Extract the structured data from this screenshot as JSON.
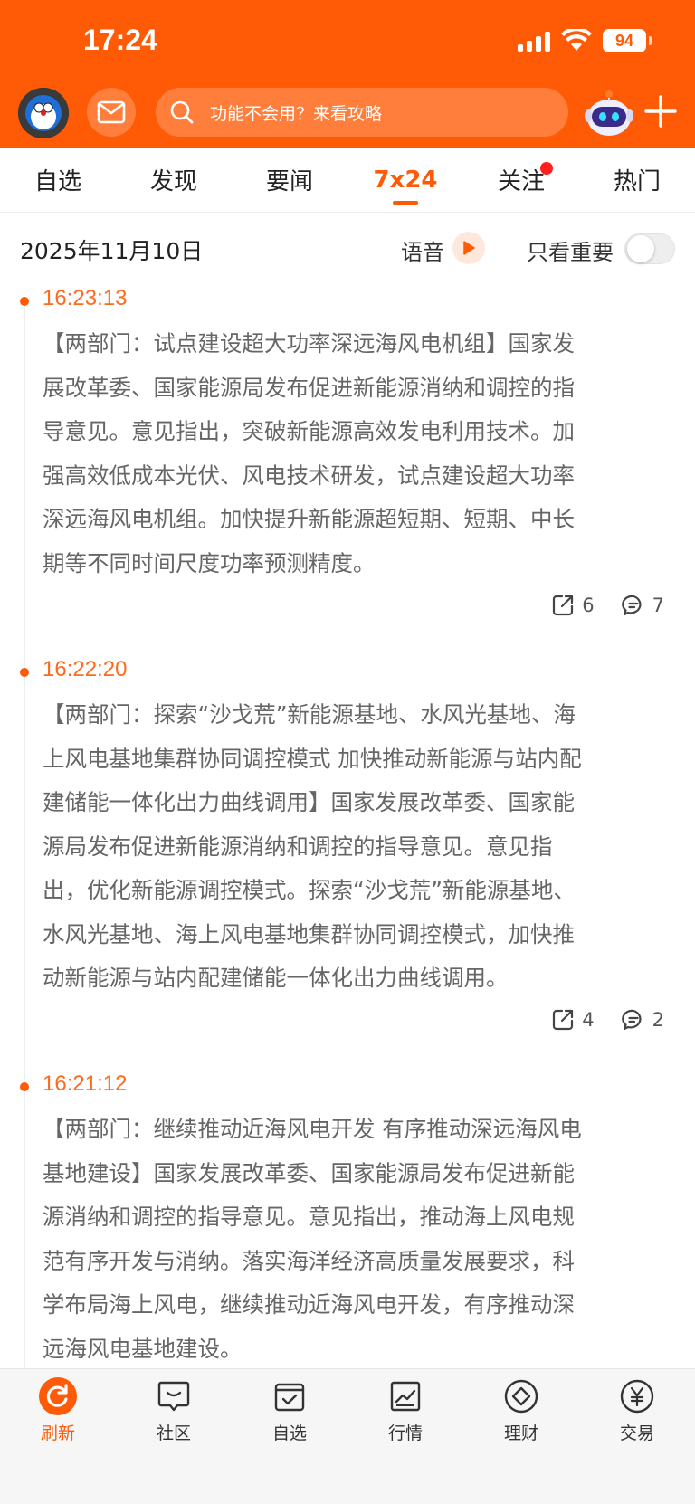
{
  "status_bar": {
    "time": "17:24",
    "battery": "94",
    "icons": [
      "signal-icon",
      "wifi-icon",
      "battery-icon"
    ]
  },
  "header": {
    "search_placeholder": "功能不会用？来看攻略",
    "icons": [
      "avatar",
      "mail-icon",
      "search-icon",
      "robot-icon",
      "plus-icon"
    ],
    "accent_color": "#ff5a05"
  },
  "tabs": [
    {
      "label": "自选",
      "active": false
    },
    {
      "label": "发现",
      "active": false
    },
    {
      "label": "要闻",
      "active": false
    },
    {
      "label": "7x24",
      "active": true
    },
    {
      "label": "关注",
      "active": false,
      "red_dot": true
    },
    {
      "label": "热门",
      "active": false
    }
  ],
  "filter_row": {
    "date": "2025年11月10日",
    "voice_label": "语音",
    "important_only_label": "只看重要",
    "important_only_on": false
  },
  "news": [
    {
      "time": "16:23:13",
      "lines": [
        "【两部门：试点建设超大功率深远海风电机组】国家发",
        "展改革委、国家能源局发布促进新能源消纳和调控的指",
        "导意见。意见指出，突破新能源高效发电利用技术。加",
        "强高效低成本光伏、风电技术研发，试点建设超大功率",
        "深远海风电机组。加快提升新能源超短期、短期、中长",
        "期等不同时间尺度功率预测精度。"
      ],
      "shares": "6",
      "comments": "7"
    },
    {
      "time": "16:22:20",
      "lines": [
        "【两部门：探索“沙戈荒”新能源基地、水风光基地、海",
        "上风电基地集群协同调控模式 加快推动新能源与站内配",
        "建储能一体化出力曲线调用】国家发展改革委、国家能",
        "源局发布促进新能源消纳和调控的指导意见。意见指",
        "出，优化新能源调控模式。探索“沙戈荒”新能源基地、",
        "水风光基地、海上风电基地集群协同调控模式，加快推",
        "动新能源与站内配建储能一体化出力曲线调用。"
      ],
      "shares": "4",
      "comments": "2"
    },
    {
      "time": "16:21:12",
      "lines": [
        "【两部门：继续推动近海风电开发 有序推动深远海风电",
        "基地建设】国家发展改革委、国家能源局发布促进新能",
        "源消纳和调控的指导意见。意见指出，推动海上风电规",
        "范有序开发与消纳。落实海洋经济高质量发展要求，科",
        "学布局海上风电，继续推动近海风电开发，有序推动深",
        "远海风电基地建设。"
      ]
    }
  ],
  "bottom_nav": [
    {
      "label": "刷新",
      "icon": "refresh-icon",
      "active": true
    },
    {
      "label": "社区",
      "icon": "chat-bubble-icon",
      "active": false
    },
    {
      "label": "自选",
      "icon": "checked-box-icon",
      "active": false
    },
    {
      "label": "行情",
      "icon": "line-chart-icon",
      "active": false
    },
    {
      "label": "理财",
      "icon": "diamond-icon",
      "active": false
    },
    {
      "label": "交易",
      "icon": "yen-icon",
      "active": false
    }
  ]
}
